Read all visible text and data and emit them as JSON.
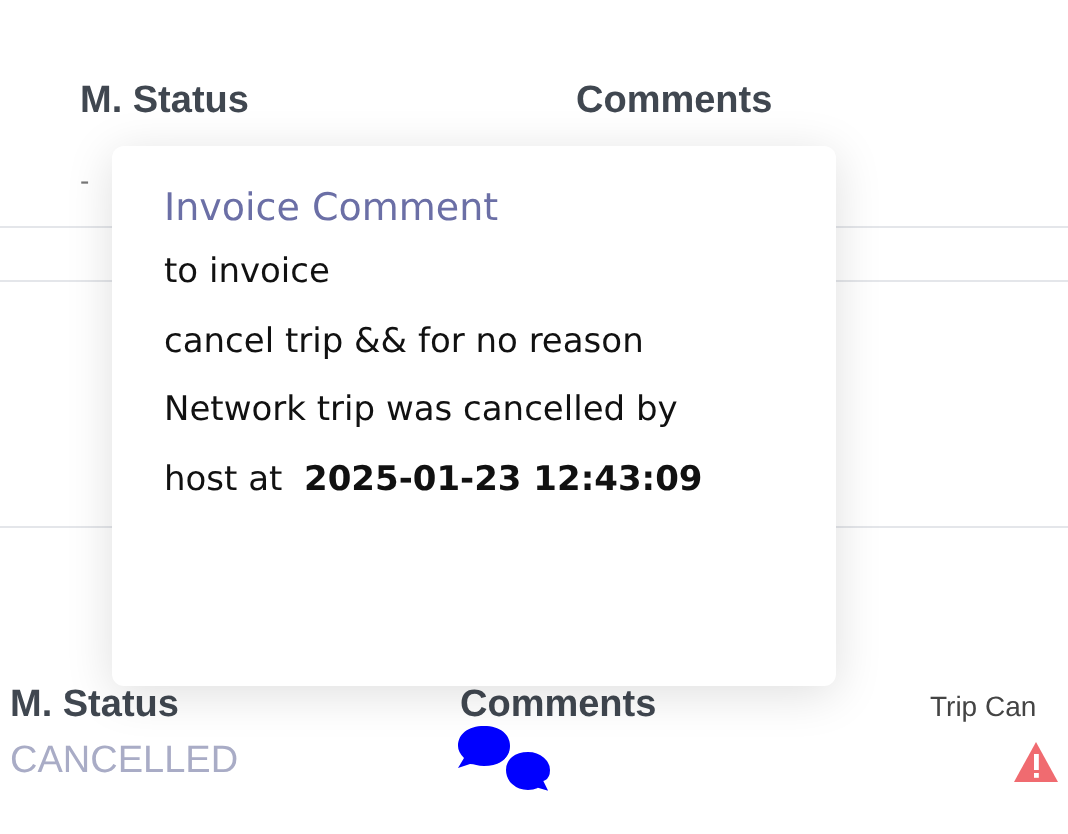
{
  "top_table": {
    "columns": [
      "M. Status",
      "Comments"
    ],
    "rows": [
      {
        "m_status": "-"
      }
    ]
  },
  "invoice_comment_popup": {
    "title": "Invoice Comment",
    "lines": [
      "to invoice",
      "cancel trip && for no reason",
      "Network trip was cancelled by host at  **2025-01-23 12:43:09**"
    ]
  },
  "bottom_table": {
    "columns": [
      "M. Status",
      "Comments",
      "Trip Can"
    ],
    "rows": [
      {
        "m_status": "CANCELLED"
      }
    ]
  }
}
